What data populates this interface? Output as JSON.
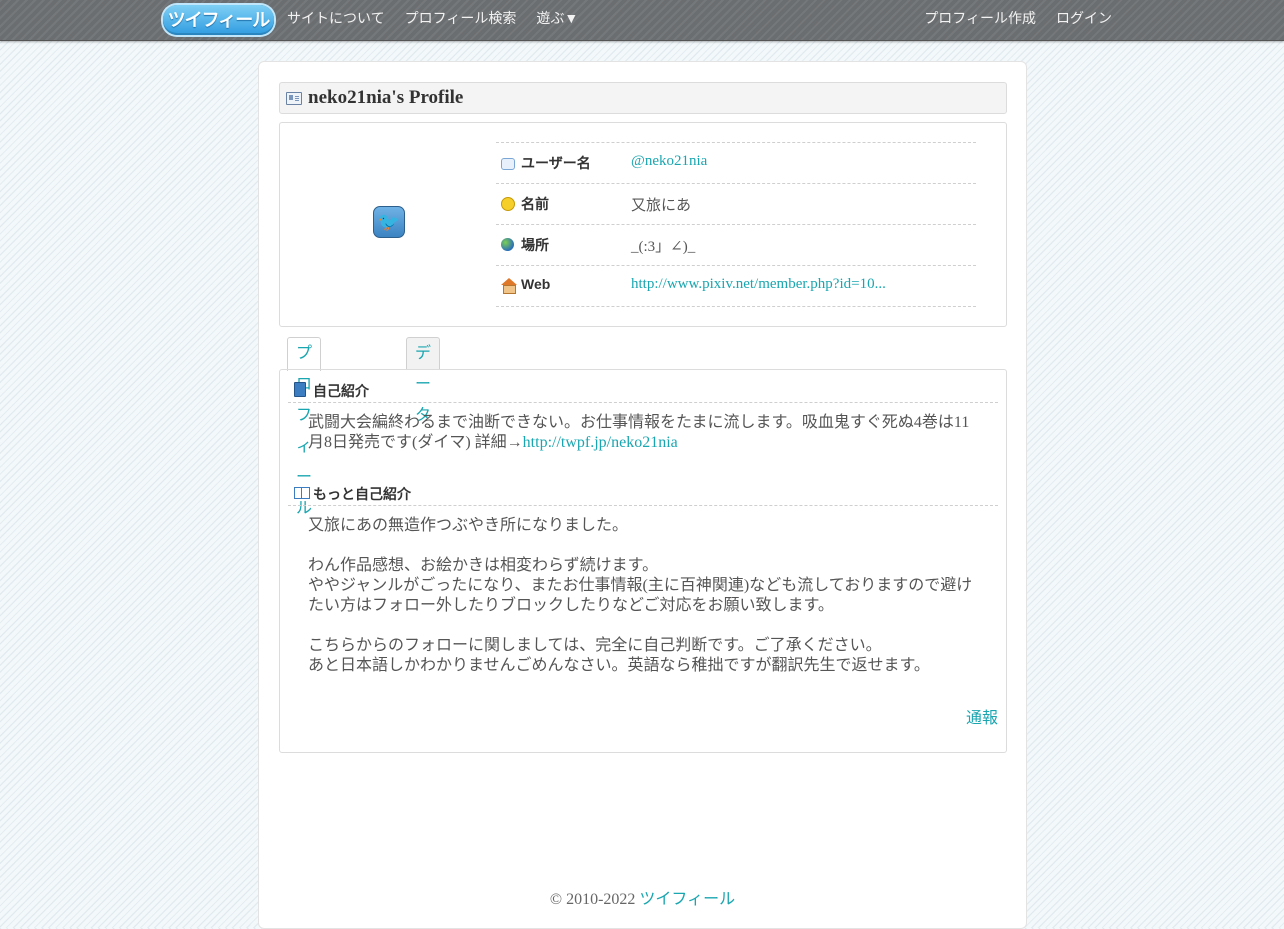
{
  "nav": {
    "logo": "ツイフィール",
    "left_items": [
      "サイトについて",
      "プロフィール検索",
      "遊ぶ▼"
    ],
    "right_items": [
      "プロフィール作成",
      "ログイン"
    ]
  },
  "profile": {
    "title": "neko21nia's Profile",
    "rows": [
      {
        "icon": "speech-bubble-icon",
        "label": "ユーザー名",
        "value": "@neko21nia",
        "link": true
      },
      {
        "icon": "smiley-icon",
        "label": "名前",
        "value": "又旅にあ",
        "link": false
      },
      {
        "icon": "globe-icon",
        "label": "場所",
        "value": "_(:3」∠)_",
        "link": false
      },
      {
        "icon": "home-icon",
        "label": "Web",
        "value": "http://www.pixiv.net/member.php?id=10...",
        "link": true
      }
    ]
  },
  "tabs": [
    "プロフィール",
    "データ"
  ],
  "sections": {
    "intro": {
      "heading": "自己紹介",
      "text": "武闘大会編終わるまで油断できない。お仕事情報をたまに流します。吸血鬼すぐ死ぬ4巻は11月8日発売です(ダイマ) 詳細→",
      "link": "http://twpf.jp/neko21nia"
    },
    "more": {
      "heading": "もっと自己紹介",
      "text": "又旅にあの無造作つぶやき所になりました。\n\nわん作品感想、お絵かきは相変わらず続けます。\nややジャンルがごったになり、またお仕事情報(主に百神関連)なども流しておりますので避けたい方はフォロー外したりブロックしたりなどご対応をお願い致します。\n\nこちらからのフォローに関しましては、完全に自己判断です。ご了承ください。\nあと日本語しかわかりませんごめんなさい。英語なら稚拙ですが翻訳先生で返せます。"
    }
  },
  "report": "通報",
  "footer": {
    "copyright": "© 2010-2022",
    "site": "ツイフィール"
  }
}
